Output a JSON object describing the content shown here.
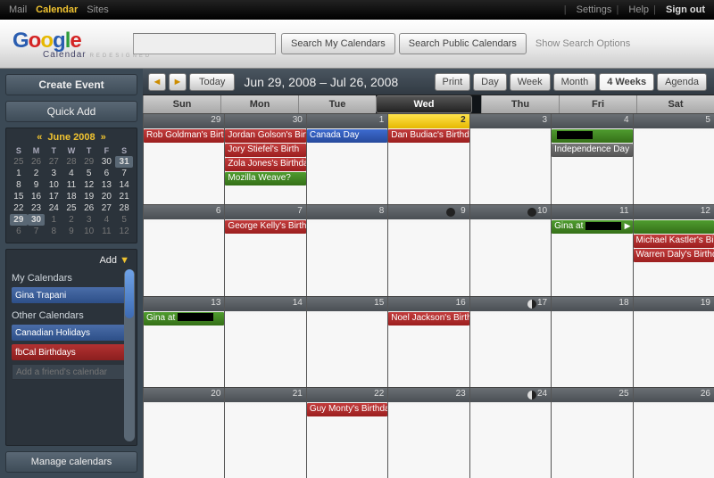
{
  "topbar": {
    "mail": "Mail",
    "calendar": "Calendar",
    "sites": "Sites",
    "settings": "Settings",
    "help": "Help",
    "signout": "Sign out"
  },
  "logo": {
    "g": "G",
    "o1": "o",
    "o2": "o",
    "g2": "g",
    "l": "l",
    "e": "e",
    "cal": "Calendar",
    "red": "REDESIGNED"
  },
  "search": {
    "btn1": "Search My Calendars",
    "btn2": "Search Public Calendars",
    "opts": "Show Search Options"
  },
  "side": {
    "create": "Create Event",
    "quick": "Quick Add",
    "mini": {
      "month": "June 2008",
      "dh": [
        "S",
        "M",
        "T",
        "W",
        "T",
        "F",
        "S"
      ],
      "rows": [
        [
          "25",
          "26",
          "27",
          "28",
          "29",
          "30",
          "31"
        ],
        [
          "1",
          "2",
          "3",
          "4",
          "5",
          "6",
          "7"
        ],
        [
          "8",
          "9",
          "10",
          "11",
          "12",
          "13",
          "14"
        ],
        [
          "15",
          "16",
          "17",
          "18",
          "19",
          "20",
          "21"
        ],
        [
          "22",
          "23",
          "24",
          "25",
          "26",
          "27",
          "28"
        ],
        [
          "29",
          "30",
          "1",
          "2",
          "3",
          "4",
          "5"
        ],
        [
          "6",
          "7",
          "8",
          "9",
          "10",
          "11",
          "12"
        ]
      ]
    },
    "add": "Add",
    "mycal": "My Calendars",
    "gina": "Gina Trapani",
    "other": "Other Calendars",
    "can": "Canadian Holidays",
    "fb": "fbCal Birthdays",
    "friend": "Add a friend's calendar",
    "manage": "Manage calendars"
  },
  "toolbar": {
    "today": "Today",
    "range": "Jun 29, 2008 – Jul 26, 2008",
    "print": "Print",
    "day": "Day",
    "week": "Week",
    "month": "Month",
    "w4": "4 Weeks",
    "agenda": "Agenda"
  },
  "days": [
    "Sun",
    "Mon",
    "Tue",
    "Wed",
    "Thu",
    "Fri",
    "Sat"
  ],
  "weeks": [
    {
      "nums": [
        "29",
        "30",
        "1",
        "2",
        "3",
        "4",
        "5"
      ],
      "today": 3,
      "events": [
        [
          {
            "t": "Rob Goldman's Birth",
            "c": "red"
          }
        ],
        [
          {
            "t": "Jordan Golson's Birt",
            "c": "red"
          },
          {
            "t": "Jory Stiefel's Birth",
            "c": "red"
          },
          {
            "t": "Zola Jones's Birthda",
            "c": "red"
          },
          {
            "t": "Mozilla Weave?",
            "c": "green"
          }
        ],
        [
          {
            "t": "Canada Day",
            "c": "blue"
          }
        ],
        [
          {
            "t": "Dan Budiac's Birthda",
            "c": "red"
          }
        ],
        [],
        [
          {
            "t": "",
            "c": "green",
            "blk": true
          },
          {
            "t": "Independence Day",
            "c": "gray"
          }
        ],
        []
      ]
    },
    {
      "nums": [
        "6",
        "7",
        "8",
        "9",
        "10",
        "11",
        "12"
      ],
      "moon": {
        "3": "new",
        "4": "new"
      },
      "events": [
        [],
        [
          {
            "t": "George Kelly's Birthd",
            "c": "red"
          }
        ],
        [],
        [],
        [],
        [
          {
            "t": "Gina at ",
            "c": "green",
            "blk": true,
            "cont": true
          }
        ],
        [
          {
            "t": "",
            "c": "green"
          },
          {
            "t": "Michael Kastler's Bir",
            "c": "red"
          },
          {
            "t": "Warren Daly's Birthd",
            "c": "red"
          }
        ]
      ]
    },
    {
      "nums": [
        "13",
        "14",
        "15",
        "16",
        "17",
        "18",
        "19"
      ],
      "moon": {
        "4": "half"
      },
      "events": [
        [
          {
            "t": "Gina at ",
            "c": "green",
            "blk": true
          }
        ],
        [],
        [],
        [
          {
            "t": "Noel Jackson's Birth",
            "c": "red"
          }
        ],
        [],
        [],
        []
      ]
    },
    {
      "nums": [
        "20",
        "21",
        "22",
        "23",
        "24",
        "25",
        "26"
      ],
      "moon": {
        "4": "half"
      },
      "events": [
        [],
        [],
        [
          {
            "t": "Guy Monty's Birthda",
            "c": "red"
          }
        ],
        [],
        [],
        [],
        []
      ]
    }
  ]
}
